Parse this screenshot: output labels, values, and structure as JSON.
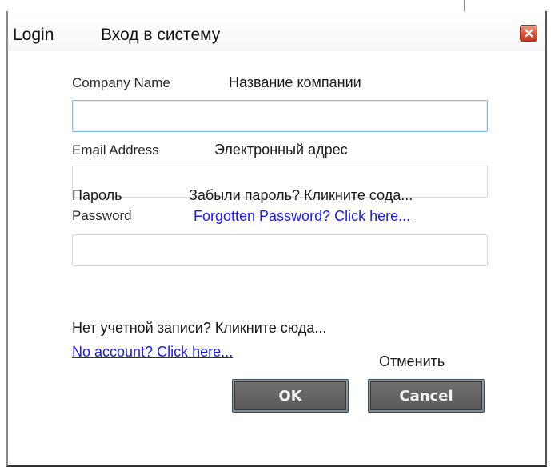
{
  "window": {
    "title_en": "Login",
    "title_ru": "Вход в систему"
  },
  "company": {
    "label_en": "Company Name",
    "label_ru": "Название компании",
    "value": ""
  },
  "email": {
    "label_en": "Email Address",
    "label_ru": "Электронный адрес",
    "value": ""
  },
  "password": {
    "label_ru": "Пароль",
    "label_en": "Password",
    "forgot_ru": "Забыли пароль? Кликните сода...",
    "forgot_en": "Forgotten Password? Click here...",
    "value": ""
  },
  "signup": {
    "text_ru": "Нет учетной записи? Кликните сюда...",
    "link_en": "No account? Click here..."
  },
  "buttons": {
    "cancel_ru": "Отменить",
    "ok_label": "OK",
    "cancel_label": "Cancel"
  },
  "colors": {
    "link": "#1a1aee",
    "button_face": "#666666",
    "close_button": "#d45a3f"
  },
  "icons": {
    "close": "close-icon"
  }
}
